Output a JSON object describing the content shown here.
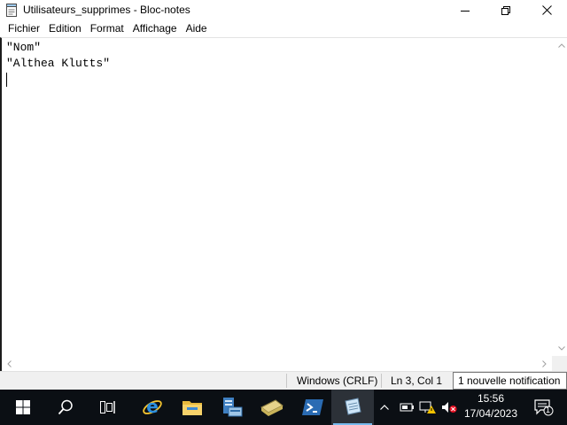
{
  "window": {
    "title": "Utilisateurs_supprimes - Bloc-notes",
    "controls": {
      "minimize": "minimize",
      "maximize": "restore",
      "close": "close"
    }
  },
  "menu": {
    "items": [
      "Fichier",
      "Edition",
      "Format",
      "Affichage",
      "Aide"
    ]
  },
  "editor": {
    "lines": [
      "\"Nom\"",
      "\"Althea Klutts\"",
      ""
    ],
    "caret_line": 3
  },
  "statusbar": {
    "encoding": "Windows (CRLF)",
    "position": "Ln 3, Col 1",
    "notification": "1 nouvelle notification"
  },
  "taskbar": {
    "apps": [
      {
        "name": "start",
        "icon": "windows-logo-icon"
      },
      {
        "name": "search",
        "icon": "search-icon"
      },
      {
        "name": "task-view",
        "icon": "task-view-icon"
      },
      {
        "name": "internet-explorer",
        "icon": "internet-explorer-icon"
      },
      {
        "name": "file-explorer",
        "icon": "folder-icon"
      },
      {
        "name": "server-manager",
        "icon": "server-manager-icon"
      },
      {
        "name": "ad-tool",
        "icon": "directory-icon"
      },
      {
        "name": "powershell",
        "icon": "powershell-icon"
      },
      {
        "name": "notepad",
        "icon": "notepad-icon",
        "active": true
      }
    ],
    "clock": {
      "time": "15:56",
      "date": "17/04/2023"
    },
    "notification_count": "1"
  },
  "colors": {
    "taskbar_bg": "#0b0f14",
    "active_indicator": "#76b9ed",
    "statusbar_bg": "#f0f0f0"
  }
}
